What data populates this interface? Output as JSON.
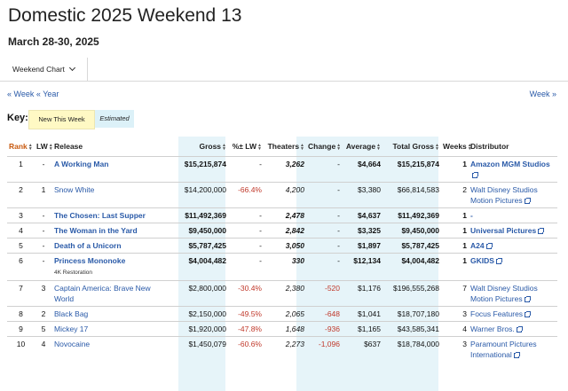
{
  "page": {
    "title": "Domestic 2025 Weekend 13",
    "subtitle": "March 28-30, 2025"
  },
  "chart_selector": {
    "label": "Weekend Chart",
    "icon": "chevron-down-icon"
  },
  "nav": {
    "prev_week": "« Week",
    "prev_year": "« Year",
    "next_week": "Week »"
  },
  "key": {
    "label": "Key:",
    "new_this_week": "New This Week",
    "estimated": "Estimated",
    "colors": {
      "new": "#fff9c4",
      "estimated": "#dcf1f8"
    }
  },
  "table": {
    "headers": [
      "Rank",
      "LW",
      "Release",
      "Gross",
      "%± LW",
      "Theaters",
      "Change",
      "Average",
      "Total Gross",
      "Weeks",
      "Distributor"
    ],
    "rows": [
      {
        "rank": "1",
        "lw": "-",
        "release": "A Working Man",
        "sub": "",
        "gross": "$15,215,874",
        "pct": "-",
        "theaters": "3,262",
        "change": "-",
        "average": "$4,664",
        "total": "$15,215,874",
        "weeks": "1",
        "distributor": "Amazon MGM Studios",
        "new": true
      },
      {
        "rank": "2",
        "lw": "1",
        "release": "Snow White",
        "sub": "",
        "gross": "$14,200,000",
        "pct": "-66.4%",
        "theaters": "4,200",
        "change": "-",
        "average": "$3,380",
        "total": "$66,814,583",
        "weeks": "2",
        "distributor": "Walt Disney Studios Motion Pictures",
        "new": false
      },
      {
        "rank": "3",
        "lw": "-",
        "release": "The Chosen: Last Supper",
        "sub": "",
        "gross": "$11,492,369",
        "pct": "-",
        "theaters": "2,478",
        "change": "-",
        "average": "$4,637",
        "total": "$11,492,369",
        "weeks": "1",
        "distributor": "-",
        "new": true
      },
      {
        "rank": "4",
        "lw": "-",
        "release": "The Woman in the Yard",
        "sub": "",
        "gross": "$9,450,000",
        "pct": "-",
        "theaters": "2,842",
        "change": "-",
        "average": "$3,325",
        "total": "$9,450,000",
        "weeks": "1",
        "distributor": "Universal Pictures",
        "new": true
      },
      {
        "rank": "5",
        "lw": "-",
        "release": "Death of a Unicorn",
        "sub": "",
        "gross": "$5,787,425",
        "pct": "-",
        "theaters": "3,050",
        "change": "-",
        "average": "$1,897",
        "total": "$5,787,425",
        "weeks": "1",
        "distributor": "A24",
        "new": true
      },
      {
        "rank": "6",
        "lw": "-",
        "release": "Princess Mononoke",
        "sub": "4K Restoration",
        "gross": "$4,004,482",
        "pct": "-",
        "theaters": "330",
        "change": "-",
        "average": "$12,134",
        "total": "$4,004,482",
        "weeks": "1",
        "distributor": "GKIDS",
        "new": true
      },
      {
        "rank": "7",
        "lw": "3",
        "release": "Captain America: Brave New World",
        "sub": "",
        "gross": "$2,800,000",
        "pct": "-30.4%",
        "theaters": "2,380",
        "change": "-520",
        "average": "$1,176",
        "total": "$196,555,268",
        "weeks": "7",
        "distributor": "Walt Disney Studios Motion Pictures",
        "new": false
      },
      {
        "rank": "8",
        "lw": "2",
        "release": "Black Bag",
        "sub": "",
        "gross": "$2,150,000",
        "pct": "-49.5%",
        "theaters": "2,065",
        "change": "-648",
        "average": "$1,041",
        "total": "$18,707,180",
        "weeks": "3",
        "distributor": "Focus Features",
        "new": false
      },
      {
        "rank": "9",
        "lw": "5",
        "release": "Mickey 17",
        "sub": "",
        "gross": "$1,920,000",
        "pct": "-47.8%",
        "theaters": "1,648",
        "change": "-936",
        "average": "$1,165",
        "total": "$43,585,341",
        "weeks": "4",
        "distributor": "Warner Bros.",
        "new": false
      },
      {
        "rank": "10",
        "lw": "4",
        "release": "Novocaine",
        "sub": "",
        "gross": "$1,450,079",
        "pct": "-60.6%",
        "theaters": "2,273",
        "change": "-1,096",
        "average": "$637",
        "total": "$18,784,000",
        "weeks": "3",
        "distributor": "Paramount Pictures International",
        "new": false
      }
    ]
  }
}
